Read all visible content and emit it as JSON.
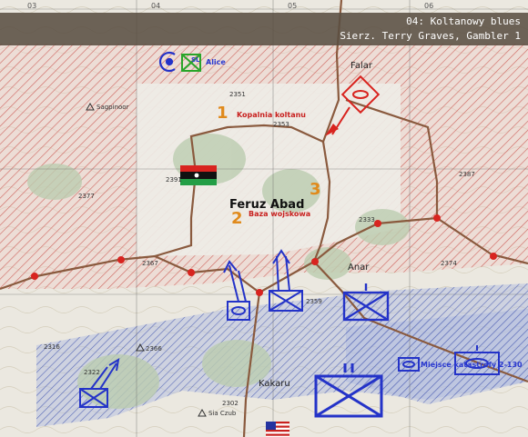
{
  "header": {
    "title": "04: Koltanowy blues",
    "subtitle": "Sierz. Terry Graves, Gambler 1"
  },
  "grid_labels": [
    "03",
    "04",
    "05",
    "06"
  ],
  "places": {
    "falar": "Falar",
    "feruz_abad": "Feruz Abad",
    "anar": "Anar",
    "kakaru": "Kakaru",
    "sagpinoor": "Sagpinoor",
    "sia_czub": "Sia Czub"
  },
  "markers": {
    "kopalnia": "Kopalnia koltanu",
    "baza": "Baza wojskowa",
    "miejsce": "Miejsce katastrofy 2-130",
    "alice": "Alice",
    "sl": "SL"
  },
  "objective_numbers": {
    "one": "1",
    "two": "2",
    "three": "3"
  },
  "elevations": [
    "2351",
    "2353",
    "2377",
    "2387",
    "2391",
    "2367",
    "2333",
    "2374",
    "2359",
    "2366",
    "2316",
    "2302",
    "2322"
  ],
  "colors": {
    "enemy_red": "#d8241f",
    "friendly_blue": "#2433c8",
    "objective_orange": "#e08a1c",
    "header_bg": "#5a4e42"
  },
  "icons": [
    "libya-flag-icon",
    "usa-flag-icon",
    "infantry-unit-icon",
    "armor-unit-icon",
    "attack-arrow-icon"
  ]
}
